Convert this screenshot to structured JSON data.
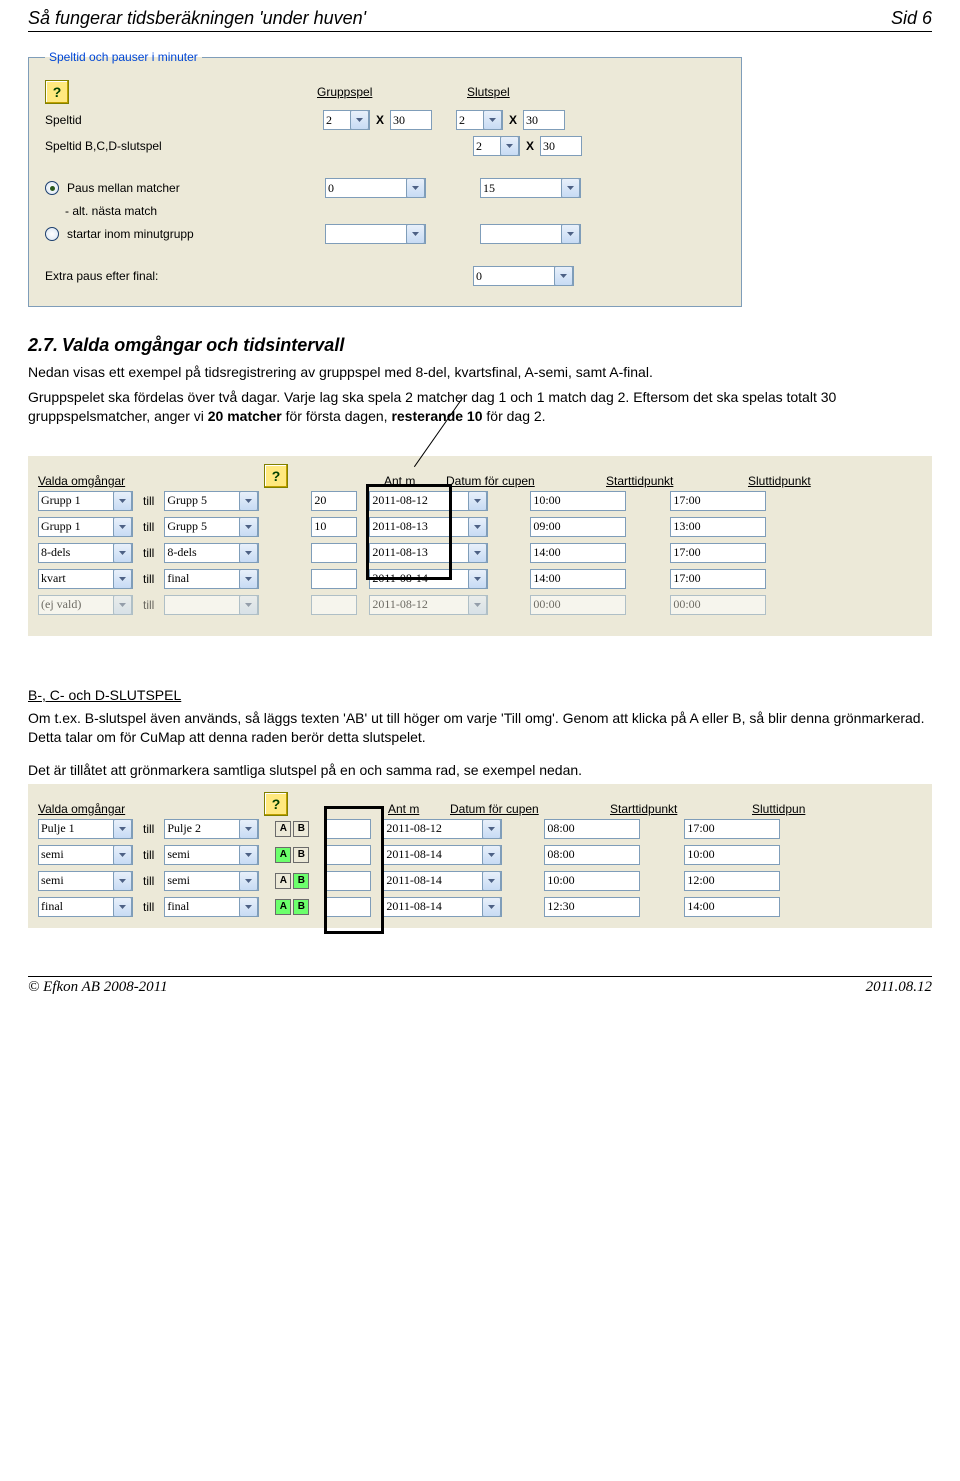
{
  "header": {
    "title": "Så fungerar tidsberäkningen 'under huven'",
    "page": "Sid 6"
  },
  "panel1": {
    "legend": "Speltid och pauser i minuter",
    "col_gruppspel": "Gruppspel",
    "col_slutspel": "Slutspel",
    "lbl_speltid": "Speltid",
    "lbl_speltid_bcd": "Speltid B,C,D-slutspel",
    "grupp_halves": "2",
    "grupp_min": "30",
    "slut_halves": "2",
    "slut_min": "30",
    "bcd_halves": "2",
    "bcd_min": "30",
    "lbl_paus": "Paus mellan matcher",
    "paus_grupp": "0",
    "paus_slut": "15",
    "lbl_alt": "- alt. nästa match",
    "lbl_startar": "startar inom minutgrupp",
    "start_grupp": "",
    "start_slut": "",
    "lbl_extra": "Extra paus efter final:",
    "extra_slut": "0"
  },
  "section27": {
    "num": "2.7.",
    "title": "Valda omgångar och tidsintervall",
    "p1": "Nedan visas ett exempel på tidsregistrering av gruppspel med 8-del, kvartsfinal, A-semi, samt A-final.",
    "p2a": "Gruppspelet ska fördelas över två dagar. Varje lag ska spela 2 matcher dag 1 och 1 match dag 2. Eftersom det ska spelas totalt 30 gruppspelsmatcher, anger vi ",
    "p2b_bold": "20 matcher",
    "p2c": " för första dagen, ",
    "p2d_bold": "resterande 10",
    "p2e": " för dag 2."
  },
  "strip1": {
    "h_valda": "Valda omgångar",
    "h_antm": "Ant m",
    "h_datum": "Datum för cupen",
    "h_start": "Starttidpunkt",
    "h_slut": "Sluttidpunkt",
    "till": "till",
    "rows": [
      {
        "from": "Grupp 1",
        "to": "Grupp 5",
        "antm": "20",
        "date": "2011-08-12",
        "start": "10:00",
        "end": "17:00"
      },
      {
        "from": "Grupp 1",
        "to": "Grupp 5",
        "antm": "10",
        "date": "2011-08-13",
        "start": "09:00",
        "end": "13:00"
      },
      {
        "from": "8-dels",
        "to": "8-dels",
        "antm": "",
        "date": "2011-08-13",
        "start": "14:00",
        "end": "17:00"
      },
      {
        "from": "kvart",
        "to": "final",
        "antm": "",
        "date": "2011-08-14",
        "start": "14:00",
        "end": "17:00"
      },
      {
        "from": "(ej vald)",
        "to": "",
        "antm": "",
        "date": "2011-08-12",
        "start": "00:00",
        "end": "00:00"
      }
    ]
  },
  "bcd": {
    "h": "B-, C- och D-SLUTSPEL",
    "p1": "Om t.ex. B-slutspel även används, så läggs texten 'AB' ut till höger om varje 'Till omg'. Genom att klicka på A eller B, så blir denna grönmarkerad. Detta talar om för CuMap att denna raden berör detta slutspelet.",
    "p2": "Det är tillåtet att grönmarkera samtliga slutspel på en och samma rad, se exempel nedan."
  },
  "strip2": {
    "h_valda": "Valda omgångar",
    "h_antm": "Ant m",
    "h_datum": "Datum för cupen",
    "h_start": "Starttidpunkt",
    "h_slut": "Sluttidpun",
    "till": "till",
    "rows": [
      {
        "from": "Pulje 1",
        "to": "Pulje 2",
        "A": "off",
        "B": "off",
        "antm": "",
        "date": "2011-08-12",
        "start": "08:00",
        "end": "17:00"
      },
      {
        "from": "semi",
        "to": "semi",
        "A": "on",
        "B": "off",
        "antm": "",
        "date": "2011-08-14",
        "start": "08:00",
        "end": "10:00"
      },
      {
        "from": "semi",
        "to": "semi",
        "A": "off",
        "B": "on",
        "antm": "",
        "date": "2011-08-14",
        "start": "10:00",
        "end": "12:00"
      },
      {
        "from": "final",
        "to": "final",
        "A": "on",
        "B": "on",
        "antm": "",
        "date": "2011-08-14",
        "start": "12:30",
        "end": "14:00"
      }
    ]
  },
  "footer": {
    "left": "© Efkon AB 2008-2011",
    "right": "2011.08.12"
  }
}
